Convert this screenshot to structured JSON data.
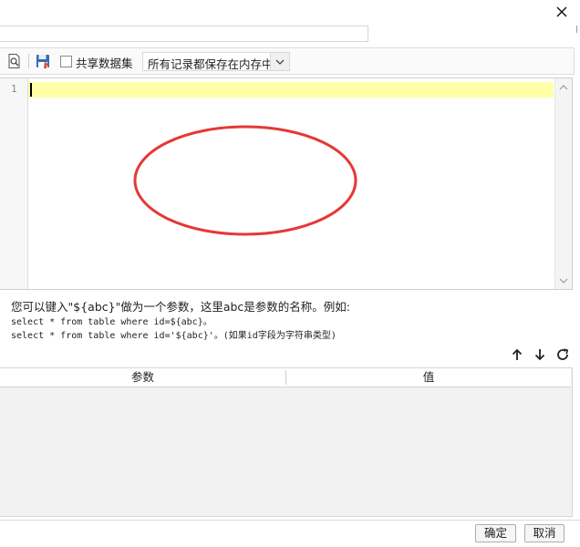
{
  "title_bar": {
    "close_icon": "close-icon"
  },
  "name_input": {
    "value": "",
    "placeholder": ""
  },
  "toolbar": {
    "preview_icon": "preview-icon",
    "save_icon": "floppy-save-icon",
    "share_checked": false,
    "share_label": "共享数据集",
    "mode_selected": "所有记录都保存在内存中"
  },
  "editor": {
    "line_numbers": [
      "1"
    ],
    "content": "",
    "current_line_color": "#ffffa8"
  },
  "annotation": {
    "color": "#e53935"
  },
  "help": {
    "line1": "您可以键入\"${abc}\"做为一个参数，这里abc是参数的名称。例如:",
    "line2": "select * from table where id=${abc}。",
    "line3": "select * from table where id='${abc}'。(如果id字段为字符串类型)"
  },
  "param_actions": {
    "up_icon": "arrow-up-icon",
    "down_icon": "arrow-down-icon",
    "refresh_icon": "refresh-icon"
  },
  "param_table": {
    "columns": [
      "参数",
      "值"
    ],
    "rows": []
  },
  "footer": {
    "ok_label": "确定",
    "cancel_label": "取消"
  }
}
